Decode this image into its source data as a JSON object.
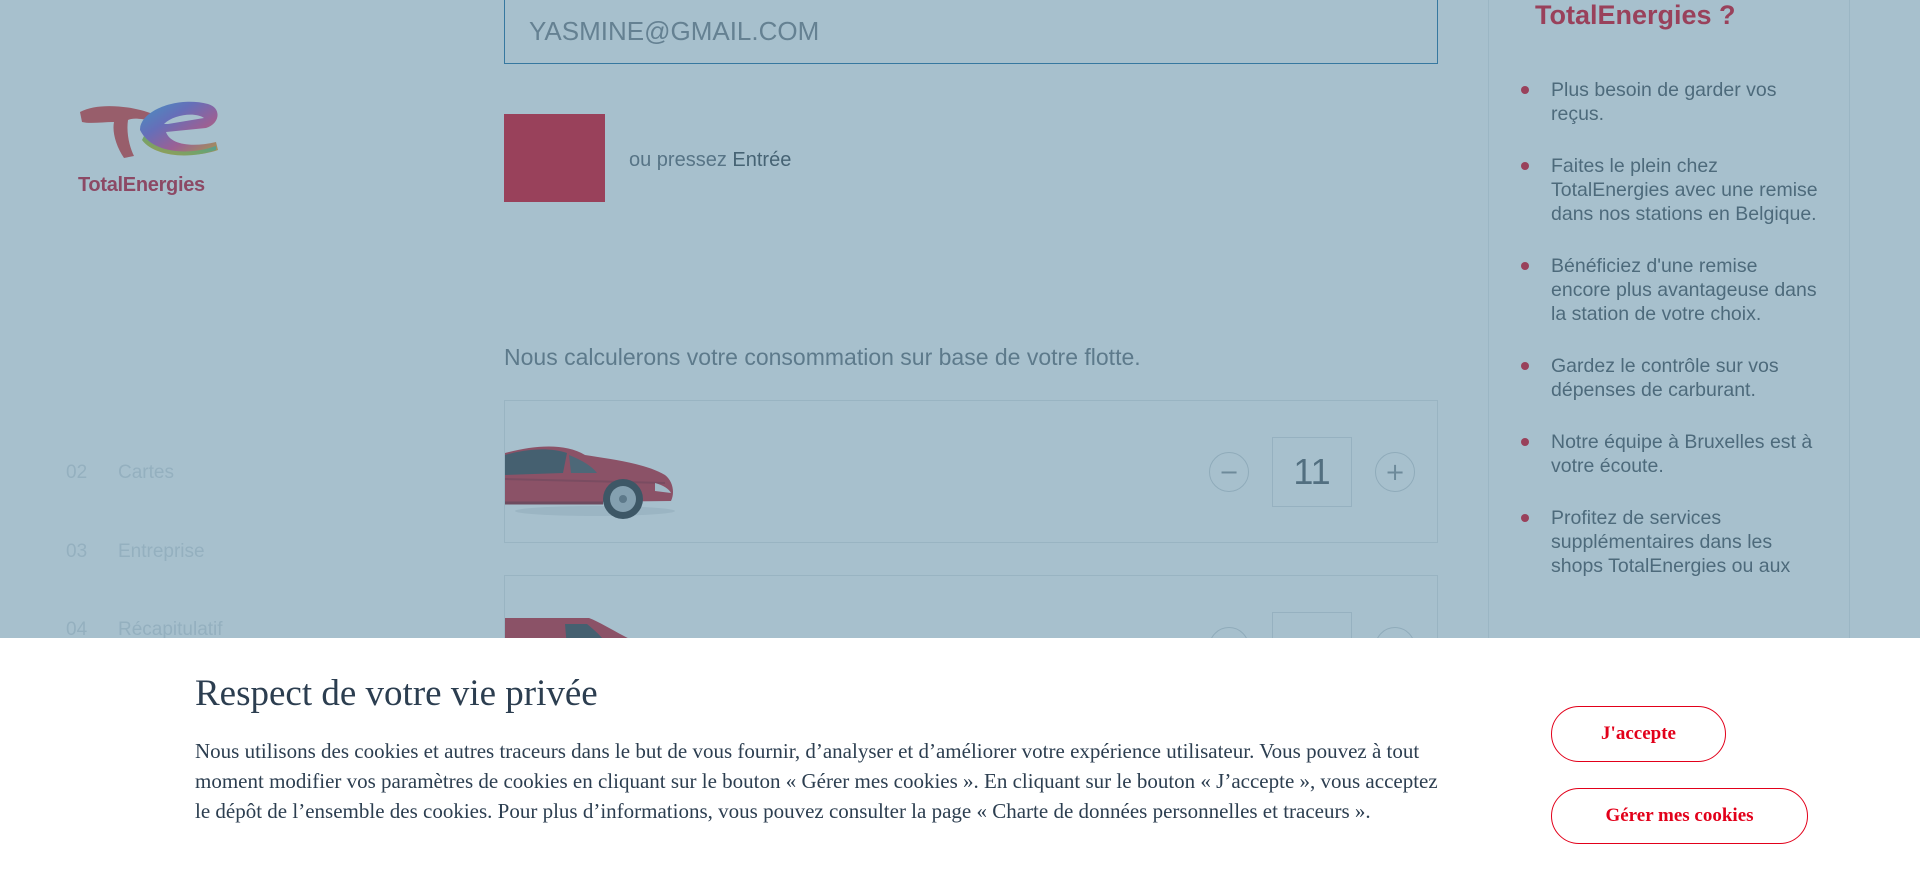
{
  "brand": {
    "name": "TotalEnergies",
    "accent_color": "#e2001a"
  },
  "sidebar": {
    "steps": [
      {
        "num": "02",
        "label": "Cartes"
      },
      {
        "num": "03",
        "label": "Entreprise"
      },
      {
        "num": "04",
        "label": "Récapitulatif"
      }
    ]
  },
  "form": {
    "email_value": "YASMINE@GMAIL.COM",
    "enter_hint_prefix": "ou pressez",
    "enter_hint_key": "Entrée",
    "fleet_label": "Nous calculerons votre consommation sur base de votre flotte.",
    "vehicles": [
      {
        "type": "car",
        "icon": "car-icon",
        "count": "11"
      },
      {
        "type": "van",
        "icon": "van-icon",
        "count": ""
      }
    ],
    "minus_icon": "−",
    "plus_icon": "+"
  },
  "aside": {
    "title": "TotalEnergies ?",
    "benefits": [
      "Plus besoin de garder vos reçus.",
      "Faites le plein chez TotalEnergies avec une remise dans nos stations en Belgique.",
      "Bénéficiez d'une remise encore plus avantageuse dans la station de votre choix.",
      "Gardez le contrôle sur vos dépenses de carburant.",
      "Notre équipe à Bruxelles est à votre écoute.",
      "Profitez de services supplémentaires dans les shops TotalEnergies ou aux"
    ]
  },
  "cookie_banner": {
    "title": "Respect de votre vie privée",
    "text": "Nous utilisons des cookies et autres traceurs dans le but de vous fournir, d’analyser et d’améliorer votre expérience utilisateur. Vous pouvez à tout moment modifier vos paramètres de cookies en cliquant sur le bouton « Gérer mes cookies ». En cliquant sur le bouton « J’accepte », vous acceptez le dépôt de l’ensemble des cookies. Pour plus d’informations, vous pouvez consulter la page « Charte de données personnelles et traceurs ».",
    "accept_label": "J'accepte",
    "manage_label": "Gérer mes cookies"
  }
}
